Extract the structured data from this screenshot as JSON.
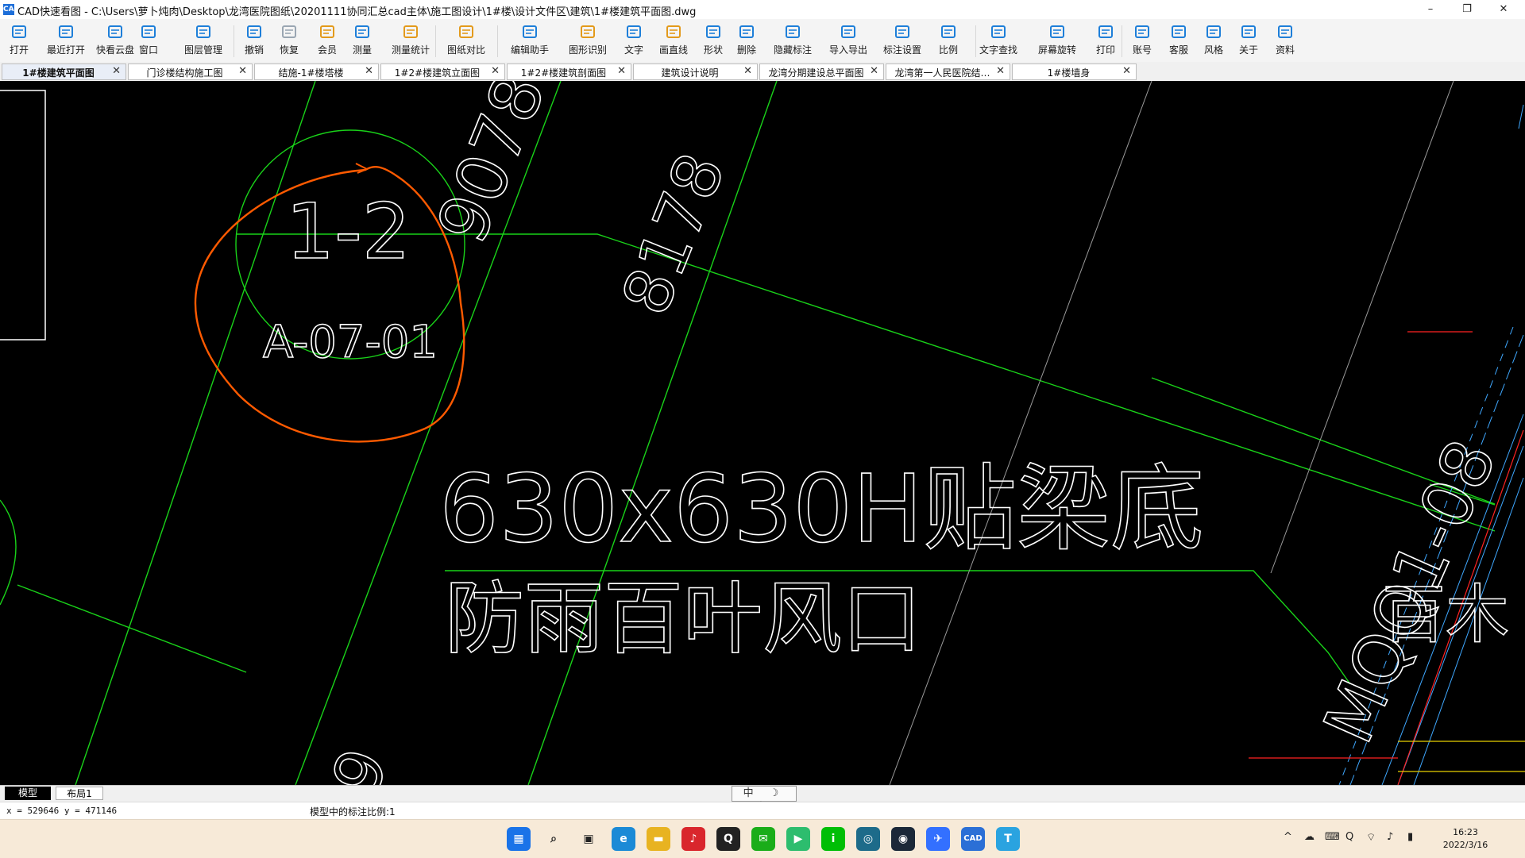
{
  "window": {
    "icon": "CAD",
    "title": "CAD快速看图 - C:\\Users\\萝卜炖肉\\Desktop\\龙湾医院图纸\\20201111协同汇总cad主体\\施工图设计\\1#楼\\设计文件区\\建筑\\1#楼建筑平面图.dwg",
    "minimize": "–",
    "maximize": "❐",
    "close": "✕"
  },
  "toolbar": [
    {
      "label": "打开",
      "icon": "folder-open-icon",
      "color": "#1e7fd9"
    },
    {
      "label": "最近打开",
      "icon": "history-icon",
      "color": "#1e7fd9"
    },
    {
      "label": "快看云盘",
      "icon": "cloud-icon",
      "color": "#1e7fd9"
    },
    {
      "label": "窗口",
      "icon": "window-icon",
      "color": "#1e7fd9"
    },
    {
      "label": "图层管理",
      "icon": "layers-icon",
      "color": "#1e7fd9"
    },
    {
      "label": "撤销",
      "icon": "undo-icon",
      "color": "#1e7fd9"
    },
    {
      "label": "恢复",
      "icon": "redo-icon",
      "color": "#9aa6b2"
    },
    {
      "label": "会员",
      "icon": "vip-icon",
      "color": "#e39a1b"
    },
    {
      "label": "测量",
      "icon": "ruler-icon",
      "color": "#1e7fd9"
    },
    {
      "label": "测量统计",
      "icon": "measure-stats-icon",
      "color": "#e39a1b"
    },
    {
      "label": "图纸对比",
      "icon": "compare-icon",
      "color": "#e39a1b"
    },
    {
      "label": "编辑助手",
      "icon": "edit-assistant-icon",
      "color": "#1e7fd9"
    },
    {
      "label": "图形识别",
      "icon": "shape-recognize-icon",
      "color": "#e39a1b"
    },
    {
      "label": "文字",
      "icon": "text-icon",
      "color": "#1e7fd9"
    },
    {
      "label": "画直线",
      "icon": "line-icon",
      "color": "#e39a1b"
    },
    {
      "label": "形状",
      "icon": "shape-icon",
      "color": "#1e7fd9"
    },
    {
      "label": "删除",
      "icon": "eraser-icon",
      "color": "#1e7fd9"
    },
    {
      "label": "隐藏标注",
      "icon": "hide-eye-icon",
      "color": "#1e7fd9"
    },
    {
      "label": "导入导出",
      "icon": "import-export-icon",
      "color": "#1e7fd9"
    },
    {
      "label": "标注设置",
      "icon": "annotation-settings-icon",
      "color": "#1e7fd9"
    },
    {
      "label": "比例",
      "icon": "scale-icon",
      "color": "#1e7fd9"
    },
    {
      "label": "文字查找",
      "icon": "text-search-icon",
      "color": "#1e7fd9"
    },
    {
      "label": "屏幕旋转",
      "icon": "rotate-screen-icon",
      "color": "#1e7fd9"
    },
    {
      "label": "打印",
      "icon": "printer-icon",
      "color": "#1e7fd9"
    },
    {
      "label": "账号",
      "icon": "user-icon",
      "color": "#1e7fd9"
    },
    {
      "label": "客服",
      "icon": "headset-icon",
      "color": "#1e7fd9"
    },
    {
      "label": "风格",
      "icon": "style-icon",
      "color": "#1e7fd9"
    },
    {
      "label": "关于",
      "icon": "info-icon",
      "color": "#1e7fd9"
    },
    {
      "label": "资料",
      "icon": "resources-icon",
      "color": "#1e7fd9"
    }
  ],
  "tabs": [
    {
      "label": "1#楼建筑平面图",
      "active": true
    },
    {
      "label": "门诊楼结构施工图"
    },
    {
      "label": "结施-1#楼塔楼"
    },
    {
      "label": "1#2#楼建筑立面图"
    },
    {
      "label": "1#2#楼建筑剖面图"
    },
    {
      "label": "建筑设计说明"
    },
    {
      "label": "龙湾分期建设总平面图"
    },
    {
      "label": "龙湾第一人民医院结…"
    },
    {
      "label": "1#楼墙身"
    }
  ],
  "tab_close": "✕",
  "drawing": {
    "ref_top": "1-2",
    "ref_bottom": "A-07-01",
    "dim_1": "9078",
    "dim_2": "8178",
    "dim_3_partial": "9",
    "note_1": "630x630H贴梁底",
    "note_2": "防雨百叶风口",
    "right_code": "MQQ1-08",
    "right_partial": "百木",
    "colors": {
      "line": "#19d219",
      "markup": "#ff5a00",
      "text": "#ffffff",
      "background": "#000000"
    }
  },
  "layout_tabs": {
    "model": "模型",
    "layout1": "布局1"
  },
  "ime": "中 ☽ 半",
  "status": {
    "coords": "x = 529646  y = 471146",
    "scale": "模型中的标注比例:1"
  },
  "taskbar": {
    "apps": [
      {
        "name": "start-icon",
        "glyph": "▦",
        "color": "#1a73e8"
      },
      {
        "name": "search-icon",
        "glyph": "⌕",
        "color": "#333333"
      },
      {
        "name": "task-view-icon",
        "glyph": "▣",
        "color": "#333333"
      },
      {
        "name": "edge-icon",
        "glyph": "e",
        "color": "#1b8ad6"
      },
      {
        "name": "file-explorer-icon",
        "glyph": "▬",
        "color": "#e8b321"
      },
      {
        "name": "netease-music-icon",
        "glyph": "♪",
        "color": "#d9262c"
      },
      {
        "name": "qq-icon",
        "glyph": "Q",
        "color": "#222222"
      },
      {
        "name": "wechat-icon",
        "glyph": "✉",
        "color": "#1aad19"
      },
      {
        "name": "video-player-icon",
        "glyph": "▶",
        "color": "#2dbd6e"
      },
      {
        "name": "iqiyi-icon",
        "glyph": "i",
        "color": "#00be06"
      },
      {
        "name": "ring-app-icon",
        "glyph": "◎",
        "color": "#1d6b8a"
      },
      {
        "name": "steam-icon",
        "glyph": "◉",
        "color": "#1b2838"
      },
      {
        "name": "feishu-icon",
        "glyph": "✈",
        "color": "#3370ff"
      },
      {
        "name": "cad-viewer-icon",
        "glyph": "CAD",
        "color": "#2b6fd6"
      },
      {
        "name": "text-app-icon",
        "glyph": "T",
        "color": "#2aa3e0"
      }
    ],
    "tray": [
      "^",
      "☁",
      "⌨",
      "Q",
      "⌔",
      "♪",
      "▮"
    ],
    "time": "16:23",
    "date": "2022/3/16"
  }
}
